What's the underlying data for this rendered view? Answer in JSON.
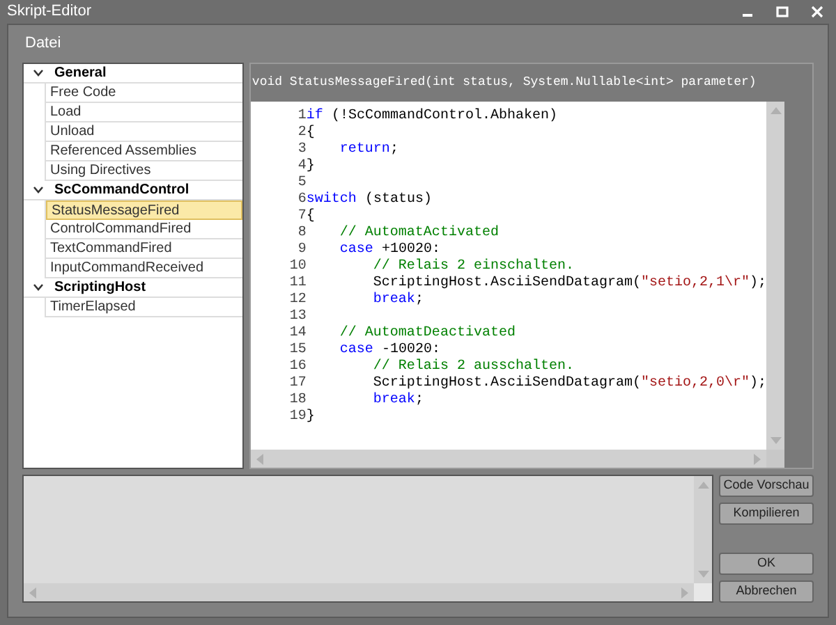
{
  "window": {
    "title": "Skript-Editor"
  },
  "menu": [
    "Datei"
  ],
  "tree": [
    {
      "label": "General",
      "expanded": true,
      "children": [
        {
          "label": "Free Code",
          "selected": false
        },
        {
          "label": "Load",
          "selected": false
        },
        {
          "label": "Unload",
          "selected": false
        },
        {
          "label": "Referenced Assemblies",
          "selected": false
        },
        {
          "label": "Using Directives",
          "selected": false
        }
      ]
    },
    {
      "label": "ScCommandControl",
      "expanded": true,
      "children": [
        {
          "label": "StatusMessageFired",
          "selected": true
        },
        {
          "label": "ControlCommandFired",
          "selected": false
        },
        {
          "label": "TextCommandFired",
          "selected": false
        },
        {
          "label": "InputCommandReceived",
          "selected": false
        }
      ]
    },
    {
      "label": "ScriptingHost",
      "expanded": true,
      "children": [
        {
          "label": "TimerElapsed",
          "selected": false
        }
      ]
    }
  ],
  "signature": "void StatusMessageFired(int status, System.Nullable<int> parameter)",
  "code": [
    {
      "number": "1",
      "tokens": [
        {
          "kind": "keyword",
          "text": "if"
        },
        {
          "kind": "plain",
          "text": " (!ScCommandControl.Abhaken)"
        }
      ]
    },
    {
      "number": "2",
      "tokens": [
        {
          "kind": "plain",
          "text": "{"
        }
      ]
    },
    {
      "number": "3",
      "tokens": [
        {
          "kind": "keyword",
          "text": "    return"
        },
        {
          "kind": "plain",
          "text": ";"
        }
      ]
    },
    {
      "number": "4",
      "tokens": [
        {
          "kind": "plain",
          "text": "}"
        }
      ]
    },
    {
      "number": "5"
    },
    {
      "number": "6",
      "tokens": [
        {
          "kind": "keyword",
          "text": "switch"
        },
        {
          "kind": "plain",
          "text": " (status)"
        }
      ]
    },
    {
      "number": "7",
      "tokens": [
        {
          "kind": "plain",
          "text": "{"
        }
      ]
    },
    {
      "number": "8",
      "tokens": [
        {
          "kind": "comment",
          "text": "    // AutomatActivated"
        }
      ]
    },
    {
      "number": "9",
      "tokens": [
        {
          "kind": "keyword",
          "text": "    case"
        },
        {
          "kind": "plain",
          "text": " +10020:"
        }
      ]
    },
    {
      "number": "10",
      "tokens": [
        {
          "kind": "comment",
          "text": "        // Relais 2 einschalten."
        }
      ]
    },
    {
      "number": "11",
      "tokens": [
        {
          "kind": "plain",
          "text": "        ScriptingHost.AsciiSendDatagram("
        },
        {
          "kind": "string",
          "text": "\"setio,2,1\\r\""
        },
        {
          "kind": "plain",
          "text": ");"
        }
      ]
    },
    {
      "number": "12",
      "tokens": [
        {
          "kind": "keyword",
          "text": "        break"
        },
        {
          "kind": "plain",
          "text": ";"
        }
      ]
    },
    {
      "number": "13"
    },
    {
      "number": "14",
      "tokens": [
        {
          "kind": "comment",
          "text": "    // AutomatDeactivated"
        }
      ]
    },
    {
      "number": "15",
      "tokens": [
        {
          "kind": "keyword",
          "text": "    case"
        },
        {
          "kind": "plain",
          "text": " -10020:"
        }
      ]
    },
    {
      "number": "16",
      "tokens": [
        {
          "kind": "comment",
          "text": "        // Relais 2 ausschalten."
        }
      ]
    },
    {
      "number": "17",
      "tokens": [
        {
          "kind": "plain",
          "text": "        ScriptingHost.AsciiSendDatagram("
        },
        {
          "kind": "string",
          "text": "\"setio,2,0\\r\""
        },
        {
          "kind": "plain",
          "text": ");"
        }
      ]
    },
    {
      "number": "18",
      "tokens": [
        {
          "kind": "keyword",
          "text": "        break"
        },
        {
          "kind": "plain",
          "text": ";"
        }
      ]
    },
    {
      "number": "19",
      "tokens": [
        {
          "kind": "plain",
          "text": "}"
        }
      ]
    }
  ],
  "buttons": [
    "Code Vorschau",
    "Kompilieren",
    "OK",
    "Abbrechen"
  ]
}
